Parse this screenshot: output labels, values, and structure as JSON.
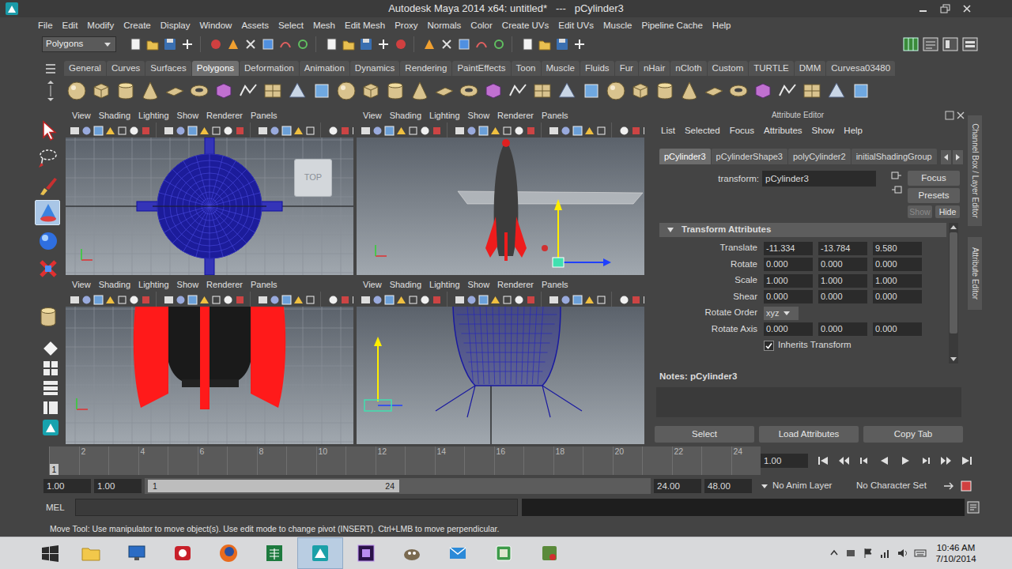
{
  "window": {
    "title": "Autodesk Maya 2014 x64: untitled*   ---   pCylinder3"
  },
  "menu_bar": [
    "File",
    "Edit",
    "Modify",
    "Create",
    "Display",
    "Window",
    "Assets",
    "Select",
    "Mesh",
    "Edit Mesh",
    "Proxy",
    "Normals",
    "Color",
    "Create UVs",
    "Edit UVs",
    "Muscle",
    "Pipeline Cache",
    "Help"
  ],
  "status_line": {
    "menu_set": "Polygons"
  },
  "shelf": {
    "tabs": [
      {
        "label": "General",
        "selected": false
      },
      {
        "label": "Curves",
        "selected": false
      },
      {
        "label": "Surfaces",
        "selected": false
      },
      {
        "label": "Polygons",
        "selected": true
      },
      {
        "label": "Deformation",
        "selected": false
      },
      {
        "label": "Animation",
        "selected": false
      },
      {
        "label": "Dynamics",
        "selected": false
      },
      {
        "label": "Rendering",
        "selected": false
      },
      {
        "label": "PaintEffects",
        "selected": false
      },
      {
        "label": "Toon",
        "selected": false
      },
      {
        "label": "Muscle",
        "selected": false
      },
      {
        "label": "Fluids",
        "selected": false
      },
      {
        "label": "Fur",
        "selected": false
      },
      {
        "label": "nHair",
        "selected": false
      },
      {
        "label": "nCloth",
        "selected": false
      },
      {
        "label": "Custom",
        "selected": false
      },
      {
        "label": "TURTLE",
        "selected": false
      },
      {
        "label": "DMM",
        "selected": false
      },
      {
        "label": "Curvesa03480",
        "selected": false
      }
    ]
  },
  "toolbox": {
    "tools": [
      {
        "selected": false
      },
      {
        "selected": false
      },
      {
        "selected": false
      },
      {
        "selected": true
      },
      {
        "selected": false
      },
      {
        "selected": false
      },
      {
        "selected": false
      }
    ]
  },
  "viewports": [
    {
      "kind": "top",
      "menus": [
        "View",
        "Shading",
        "Lighting",
        "Show",
        "Renderer",
        "Panels"
      ],
      "view_cube": "TOP"
    },
    {
      "kind": "persp",
      "menus": [
        "View",
        "Shading",
        "Lighting",
        "Show",
        "Renderer",
        "Panels"
      ]
    },
    {
      "kind": "front",
      "menus": [
        "View",
        "Shading",
        "Lighting",
        "Show",
        "Renderer",
        "Panels"
      ]
    },
    {
      "kind": "side",
      "menus": [
        "View",
        "Shading",
        "Lighting",
        "Show",
        "Renderer",
        "Panels"
      ]
    }
  ],
  "attribute_editor": {
    "title": "Attribute Editor",
    "menus": [
      "List",
      "Selected",
      "Focus",
      "Attributes",
      "Show",
      "Help"
    ],
    "tabs": [
      {
        "label": "pCylinder3",
        "selected": true
      },
      {
        "label": "pCylinderShape3",
        "selected": false
      },
      {
        "label": "polyCylinder2",
        "selected": false
      },
      {
        "label": "initialShadingGroup",
        "selected": false
      }
    ],
    "node_type": "transform:",
    "node_name": "pCylinder3",
    "buttons": [
      {
        "label": "Focus",
        "disabled": false
      },
      {
        "label": "Presets",
        "disabled": false
      },
      {
        "label": "Show",
        "disabled": true
      },
      {
        "label": "Hide",
        "disabled": false
      }
    ],
    "section": {
      "title": "Transform Attributes",
      "expanded": true
    },
    "attributes": [
      {
        "kind": "vector",
        "label": "Translate",
        "values": [
          "-11.334",
          "-13.784",
          "9.580"
        ]
      },
      {
        "kind": "vector",
        "label": "Rotate",
        "values": [
          "0.000",
          "0.000",
          "0.000"
        ]
      },
      {
        "kind": "vector",
        "label": "Scale",
        "values": [
          "1.000",
          "1.000",
          "1.000"
        ]
      },
      {
        "kind": "vector",
        "label": "Shear",
        "values": [
          "0.000",
          "0.000",
          "0.000"
        ]
      },
      {
        "kind": "dropdown",
        "label": "Rotate Order",
        "value": "xyz"
      },
      {
        "kind": "vector",
        "label": "Rotate Axis",
        "values": [
          "0.000",
          "0.000",
          "0.000"
        ]
      },
      {
        "kind": "checkbox",
        "label": "Inherits Transform",
        "checked": true
      }
    ],
    "notes": "Notes: pCylinder3",
    "bottom_buttons": [
      "Select",
      "Load Attributes",
      "Copy Tab"
    ]
  },
  "side_tabs": [
    "Channel Box / Layer Editor",
    "Attribute Editor"
  ],
  "time_slider": {
    "current_frame": "1",
    "ticks": [
      "2",
      "4",
      "6",
      "8",
      "10",
      "12",
      "14",
      "16",
      "18",
      "20",
      "22",
      "24"
    ],
    "current_time": "1.00"
  },
  "range_slider": {
    "start_time": "1.00",
    "range_start": "1.00",
    "handle_start": "1",
    "handle_end": "24",
    "level": 0.5,
    "range_end": "24.00",
    "end_time": "48.00",
    "anim_layer": "No Anim Layer",
    "character_set": "No Character Set"
  },
  "command_line": {
    "language": "MEL"
  },
  "help_line": "Move Tool: Use manipulator to move object(s). Use edit mode to change pivot (INSERT). Ctrl+LMB to move perpendicular.",
  "taskbar": {
    "apps": [
      {
        "active": false
      },
      {
        "active": false
      },
      {
        "active": false
      },
      {
        "active": false
      },
      {
        "active": false
      },
      {
        "active": true
      },
      {
        "active": false
      },
      {
        "active": false
      },
      {
        "active": false
      },
      {
        "active": false
      },
      {
        "active": false
      }
    ],
    "time": "10:46 AM",
    "date": "7/10/2014"
  }
}
